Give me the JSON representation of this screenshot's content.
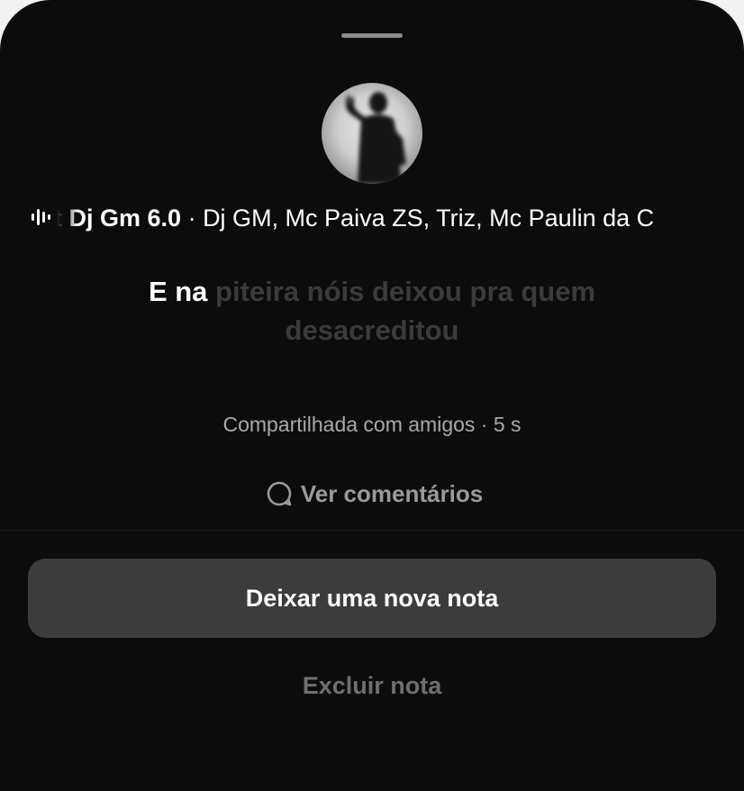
{
  "sheet": {
    "track": {
      "song": "et Dj Gm 6.0",
      "separator": " · ",
      "artists": "Dj GM, Mc Paiva ZS, Triz, Mc Paulin da C",
      "icon": "audio-waveform-icon"
    },
    "avatar": {
      "description_icon": "profile-avatar"
    },
    "lyric": {
      "sung": "E na",
      "upcoming": " piteira nóis deixou pra quem desacreditou"
    },
    "meta": "Compartilhada com amigos · 5 s",
    "comments_label": "Ver comentários",
    "comments_icon": "comment-bubble-icon",
    "primary_label": "Deixar uma nova nota",
    "delete_label": "Excluir nota"
  },
  "colors": {
    "sheet_background": "#0c0c0c",
    "button_background": "#3c3c3c",
    "lyric_dim": "#3b3b3b",
    "meta_text": "#a9a9a9",
    "delete_text": "#6f6f6f"
  }
}
